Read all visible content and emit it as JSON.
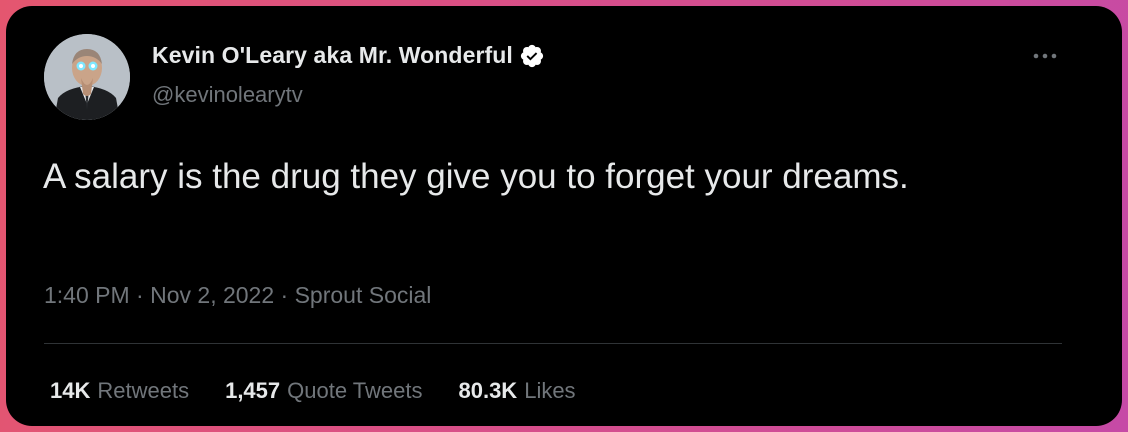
{
  "tweet": {
    "author": {
      "display_name": "Kevin O'Leary aka Mr. Wonderful",
      "handle": "@kevinolearytv",
      "verified": true,
      "avatar_icon": "profile-photo"
    },
    "text": "A salary is the drug they give you to forget your dreams.",
    "meta": {
      "time": "1:40 PM",
      "separator": " · ",
      "date": "Nov 2, 2022",
      "source": "Sprout Social"
    },
    "stats": [
      {
        "count": "14K",
        "label": "Retweets"
      },
      {
        "count": "1,457",
        "label": "Quote Tweets"
      },
      {
        "count": "80.3K",
        "label": "Likes"
      }
    ]
  },
  "colors": {
    "card_background": "#000000",
    "primary_text": "#e7e9ea",
    "secondary_text": "#71767b",
    "divider": "#2f3336",
    "verified_badge": "#ffffff"
  }
}
